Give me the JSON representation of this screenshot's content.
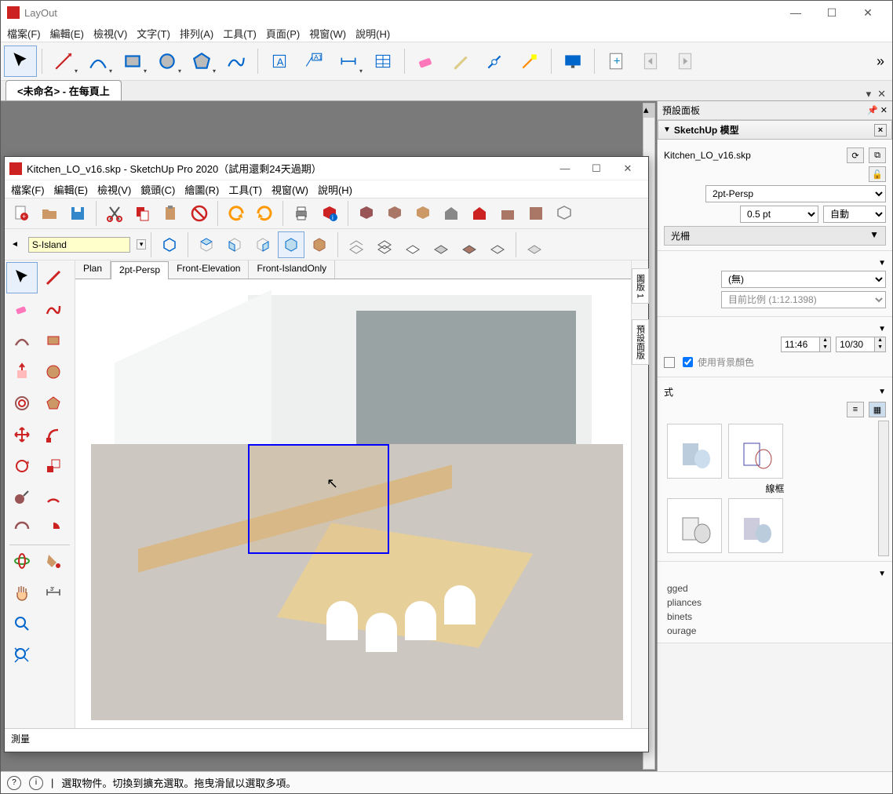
{
  "layout": {
    "title": "LayOut",
    "menus": [
      "檔案(F)",
      "編輯(E)",
      "檢視(V)",
      "文字(T)",
      "排列(A)",
      "工具(T)",
      "頁面(P)",
      "視窗(W)",
      "說明(H)"
    ],
    "doc_tab": "<未命名> - 在每頁上",
    "status": "選取物件。切換到擴充選取。拖曳滑鼠以選取多項。"
  },
  "side_panel": {
    "title": "預設面板",
    "section1_title": "SketchUp 模型",
    "filename": "Kitchen_LO_v16.skp",
    "scene_select": "2pt-Persp",
    "line_weight": "0.5 pt",
    "auto": "自動",
    "raster": "光柵",
    "scale_none": "(無)",
    "scale_current": "目前比例 (1:12.1398)",
    "time": "11:46",
    "date": "10/30",
    "use_bg": "使用背景顏色",
    "style_label1": "式",
    "style_label2": "線框",
    "tags": [
      "gged",
      "pliances",
      "binets",
      "ourage"
    ]
  },
  "sketchup": {
    "title": "Kitchen_LO_v16.skp - SketchUp Pro 2020（試用還剩24天過期）",
    "menus": [
      "檔案(F)",
      "編輯(E)",
      "檢視(V)",
      "鏡頭(C)",
      "繪圖(R)",
      "工具(T)",
      "視窗(W)",
      "說明(H)"
    ],
    "scene_combo": "S-Island",
    "scene_tabs": [
      "Plan",
      "2pt-Persp",
      "Front-Elevation",
      "Front-IslandOnly"
    ],
    "active_scene_tab": "2pt-Persp",
    "tray1": "圖版 1",
    "tray2": "預設面版",
    "measure_label": "測量",
    "status": ""
  }
}
